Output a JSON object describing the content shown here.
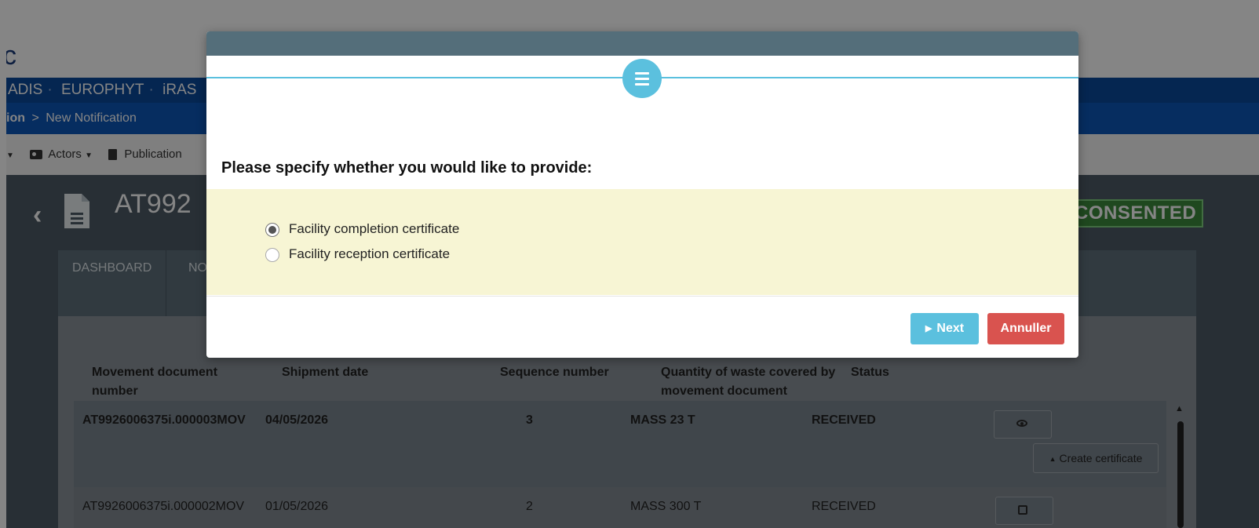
{
  "background": {
    "logo_fragment": "c",
    "system_nav": [
      "ADIS",
      "EUROPHYT",
      "iRAS"
    ],
    "breadcrumb": {
      "current_fragment": "ion",
      "separator": ">",
      "next": "New Notification"
    },
    "menu": {
      "actors_label": "Actors",
      "publications_label": "Publication"
    },
    "document": {
      "title_fragment": "AT992",
      "status": "CONSENTED"
    },
    "tabs": [
      "DASHBOARD",
      "NO"
    ],
    "table": {
      "headers": [
        "Movement document number",
        "Shipment date",
        "Sequence number",
        "Quantity of waste covered by movement document",
        "Status"
      ],
      "rows": [
        {
          "doc": "AT9926006375i.000003MOV",
          "date": "04/05/2026",
          "seq": "3",
          "qty": "MASS 23 T",
          "status": "RECEIVED"
        },
        {
          "doc": "AT9926006375i.000002MOV",
          "date": "01/05/2026",
          "seq": "2",
          "qty": "MASS 300 T",
          "status": "RECEIVED"
        }
      ],
      "create_certificate_label": "Create certificate"
    }
  },
  "modal": {
    "question": "Please specify whether you would like to provide:",
    "options": [
      {
        "label": "Facility completion certificate",
        "selected": true
      },
      {
        "label": "Facility reception certificate",
        "selected": false
      }
    ],
    "next_label": "Next",
    "cancel_label": "Annuller"
  },
  "colors": {
    "accent": "#5bc0de",
    "danger": "#d9534f",
    "nav_dark": "#0b4a9c",
    "choice_bg": "#f7f5d4",
    "status_green": "#3c8a3c"
  }
}
